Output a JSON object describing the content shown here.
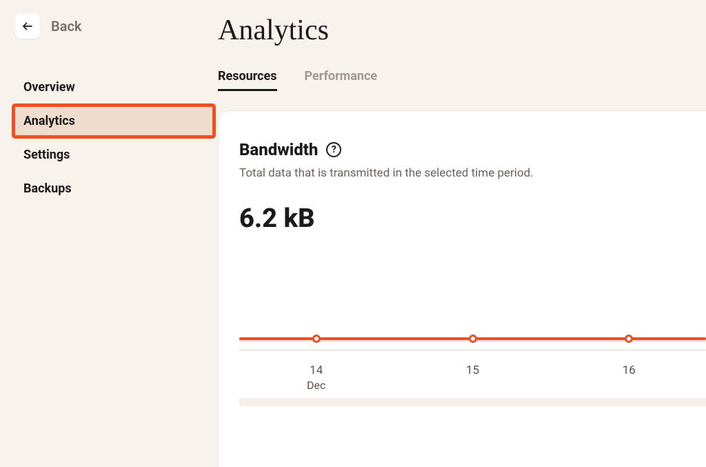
{
  "header": {
    "back_label": "Back",
    "page_title": "Analytics"
  },
  "sidebar": {
    "items": [
      {
        "label": "Overview",
        "active": false
      },
      {
        "label": "Analytics",
        "active": true
      },
      {
        "label": "Settings",
        "active": false
      },
      {
        "label": "Backups",
        "active": false
      }
    ]
  },
  "tabs": [
    {
      "label": "Resources",
      "active": true
    },
    {
      "label": "Performance",
      "active": false
    }
  ],
  "card": {
    "title": "Bandwidth",
    "help": "?",
    "description": "Total data that is transmitted in the selected time period.",
    "value": "6.2 kB"
  },
  "chart_data": {
    "type": "line",
    "title": "Bandwidth",
    "xlabel": "Dec",
    "ylabel": "",
    "x": [
      "14",
      "15",
      "16"
    ],
    "values": [
      0,
      0,
      0
    ],
    "x_month_label": "Dec",
    "colors": {
      "line": "#f04e23"
    }
  }
}
